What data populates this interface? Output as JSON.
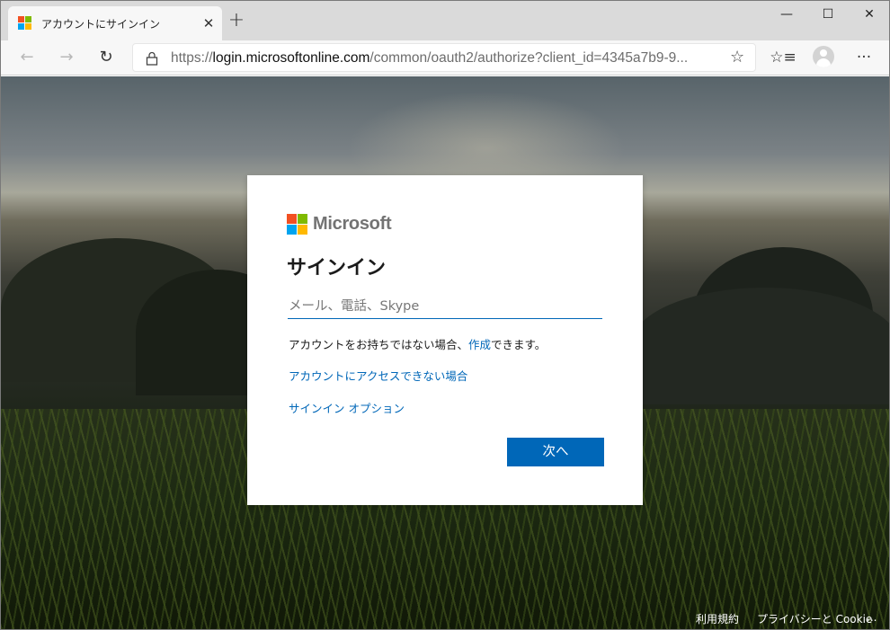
{
  "browser": {
    "tab": {
      "title": "アカウントにサインイン",
      "close_label": "✕"
    },
    "new_tab_label": "+",
    "window_controls": {
      "minimize": "—",
      "maximize": "☐",
      "close": "✕"
    },
    "nav": {
      "back": "←",
      "forward": "→",
      "refresh": "↻"
    },
    "address": {
      "scheme": "https://",
      "host": "login.microsoftonline.com",
      "path": "/common/oauth2/authorize?client_id=4345a7b9-9..."
    },
    "toolbar_icons": {
      "favorite": "☆",
      "favorites": "☆≡",
      "more": "···"
    }
  },
  "brand_colors": {
    "red": "#f25022",
    "green": "#7fba00",
    "blue": "#00a4ef",
    "yellow": "#ffb900",
    "accent": "#0067b8"
  },
  "signin": {
    "brand": "Microsoft",
    "heading": "サインイン",
    "email_placeholder": "メール、電話、Skype",
    "no_account_prefix": "アカウントをお持ちではない場合、",
    "create_link": "作成",
    "no_account_suffix": "できます。",
    "cant_access_link": "アカウントにアクセスできない場合",
    "signin_options_link": "サインイン オプション",
    "next_button": "次へ"
  },
  "footer": {
    "terms": "利用規約",
    "privacy": "プライバシーと Cookie",
    "more": "..."
  }
}
